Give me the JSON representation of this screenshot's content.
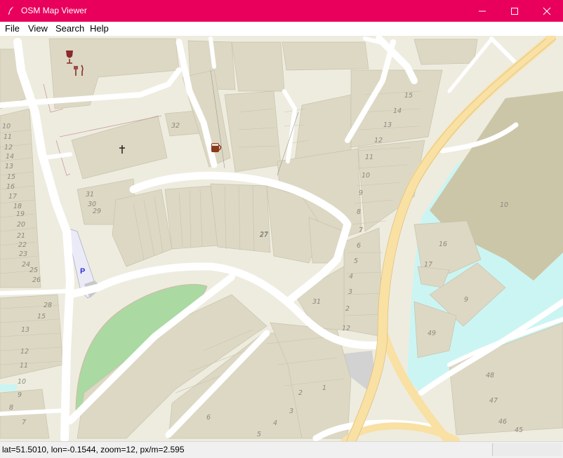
{
  "window": {
    "title": "OSM Map Viewer"
  },
  "menu": {
    "file": "File",
    "view": "View",
    "search": "Search",
    "help": "Help"
  },
  "map": {
    "colors": {
      "land": "#f2efe9",
      "building": "#d9d0c9",
      "road": "#ffffff",
      "primary": "#fcd6a4",
      "water": "#aad3df",
      "park": "#add19e",
      "parking": "#eeeeee"
    },
    "parking_label": "P",
    "house_numbers": [
      "10",
      "11",
      "12",
      "13",
      "14",
      "15",
      "16",
      "17",
      "18",
      "19",
      "20",
      "21",
      "22",
      "23",
      "24",
      "25",
      "26",
      "27",
      "28",
      "29",
      "30",
      "31",
      "32",
      "15",
      "14",
      "13",
      "12",
      "11",
      "10",
      "9",
      "8",
      "7",
      "6",
      "5",
      "4",
      "3",
      "2",
      "12",
      "31",
      "27",
      "16",
      "17",
      "9",
      "49",
      "10",
      "48",
      "47",
      "46",
      "45",
      "15",
      "13",
      "12",
      "11",
      "10",
      "9",
      "8",
      "7",
      "6",
      "5",
      "4",
      "3",
      "2",
      "1"
    ]
  },
  "status": {
    "text": "lat=51.5010, lon=-0.1544, zoom=12, px/m=2.595"
  }
}
